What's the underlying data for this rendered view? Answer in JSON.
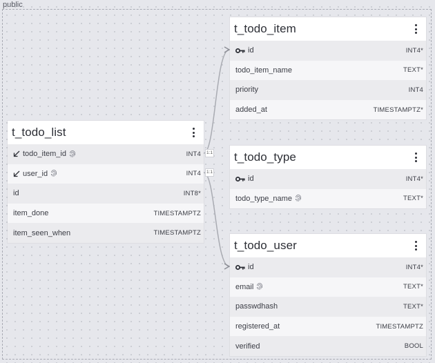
{
  "schema": {
    "label": "public"
  },
  "tables": {
    "t_todo_list": {
      "title": "t_todo_list",
      "columns": [
        {
          "name": "todo_item_id",
          "type": "INT4",
          "fk": true,
          "sensitive": true
        },
        {
          "name": "user_id",
          "type": "INT4",
          "fk": true,
          "sensitive": true
        },
        {
          "name": "id",
          "type": "INT8*"
        },
        {
          "name": "item_done",
          "type": "TIMESTAMPTZ"
        },
        {
          "name": "item_seen_when",
          "type": "TIMESTAMPTZ"
        }
      ]
    },
    "t_todo_item": {
      "title": "t_todo_item",
      "columns": [
        {
          "name": "id",
          "type": "INT4*",
          "pk": true
        },
        {
          "name": "todo_item_name",
          "type": "TEXT*"
        },
        {
          "name": "priority",
          "type": "INT4"
        },
        {
          "name": "added_at",
          "type": "TIMESTAMPTZ*"
        }
      ]
    },
    "t_todo_type": {
      "title": "t_todo_type",
      "columns": [
        {
          "name": "id",
          "type": "INT4*",
          "pk": true
        },
        {
          "name": "todo_type_name",
          "type": "TEXT*",
          "sensitive": true
        }
      ]
    },
    "t_todo_user": {
      "title": "t_todo_user",
      "columns": [
        {
          "name": "id",
          "type": "INT4*",
          "pk": true
        },
        {
          "name": "email",
          "type": "TEXT*",
          "sensitive": true
        },
        {
          "name": "passwdhash",
          "type": "TEXT*"
        },
        {
          "name": "registered_at",
          "type": "TIMESTAMPTZ"
        },
        {
          "name": "verified",
          "type": "BOOL"
        }
      ]
    }
  },
  "relations": [
    {
      "label": "1:1",
      "from": "t_todo_list.todo_item_id",
      "to": "t_todo_item.id"
    },
    {
      "label": "1:1",
      "from": "t_todo_list.user_id",
      "to": "t_todo_user.id"
    }
  ],
  "colors": {
    "canvas": "#e6e7ec",
    "edge": "#a9abb2",
    "header": "#ffffff"
  }
}
